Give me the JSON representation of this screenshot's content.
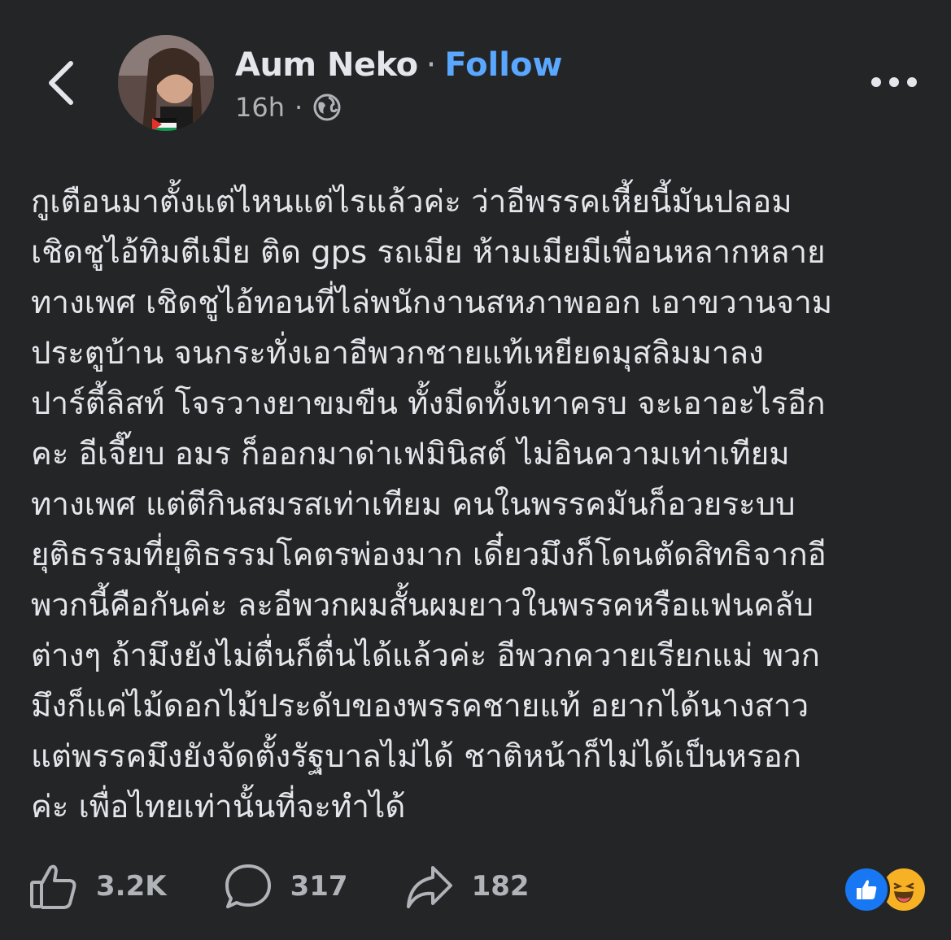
{
  "header": {
    "author_name": "Aum Neko",
    "separator": "·",
    "follow_label": "Follow",
    "timestamp": "16h",
    "meta_separator": "·",
    "audience_icon": "globe-icon",
    "back_icon": "chevron-left-icon",
    "more_icon": "more-horizontal-icon"
  },
  "post": {
    "text": "กูเตือนมาตั้งแต่ไหนแต่ไรแล้วค่ะ ว่าอีพรรคเหี้ยนี้มันปลอม\nเชิดชูไอ้ทิมตีเมีย ติด gps รถเมีย ห้ามเมียมีเพื่อนหลากหลาย\nทางเพศ เชิดชูไอ้ทอนที่ไล่พนักงานสหภาพออก เอาขวานจาม\nประตูบ้าน จนกระทั่งเอาอีพวกชายแท้เหยียดมุสลิมมาลง\nปาร์ตี้ลิสท์ โจรวางยาขมขืน ทั้งมีดทั้งเทาครบ จะเอาอะไรอีก\nคะ อีเจี๊ยบ อมร ก็ออกมาด่าเฟมินิสต์ ไม่อินความเท่าเทียม\nทางเพศ แต่ตีกินสมรสเท่าเทียม คนในพรรคมันก็อวยระบบ\nยุติธรรมที่ยุติธรรมโคตรพ่องมาก เดี๋ยวมึงก็โดนตัดสิทธิจากอี\nพวกนี้คือกันค่ะ ละอีพวกผมสั้นผมยาวในพรรคหรือแฟนคลับ\nต่างๆ ถ้ามึงยังไม่ตื่นก็ตื่นได้แล้วค่ะ อีพวกควายเรียกแม่ พวก\nมึงก็แค่ไม้ดอกไม้ประดับของพรรคชายแท้ อยากได้นางสาว\nแต่พรรคมึงยังจัดตั้งรัฐบาลไม่ได้ ชาติหน้าก็ไม่ได้เป็นหรอก\nค่ะ เพื่อไทยเท่านั้นที่จะทำได้"
  },
  "actions": {
    "like_count": "3.2K",
    "comment_count": "317",
    "share_count": "182",
    "like_icon": "thumbs-up-icon",
    "comment_icon": "comment-bubble-icon",
    "share_icon": "share-arrow-icon"
  },
  "reactions": [
    {
      "name": "like-reaction-icon"
    },
    {
      "name": "haha-reaction-icon"
    }
  ],
  "colors": {
    "background": "#242526",
    "text_primary": "#e4e6eb",
    "text_secondary": "#b0b3b8",
    "follow_link": "#5aa7ff",
    "like_blue": "#1877f2",
    "haha_yellow": "#f7b125"
  }
}
